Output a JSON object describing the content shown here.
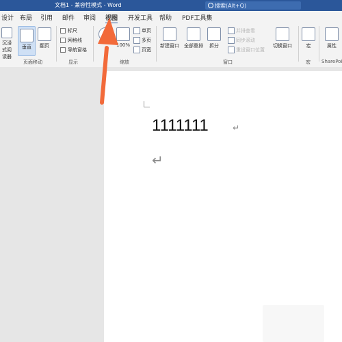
{
  "titlebar": {
    "title": "文档1 - 兼容性模式 - Word",
    "search_placeholder": "搜索(Alt+Q)"
  },
  "tabs": [
    "设计",
    "布局",
    "引用",
    "邮件",
    "审阅",
    "视图",
    "开发工具",
    "帮助",
    "PDF工具集"
  ],
  "active_tab": "视图",
  "ribbon": {
    "immersive_label": "沉浸式阅读器",
    "vertical_label": "垂直",
    "page_turn_label": "翻页",
    "page_move_group": "页面移动",
    "show_group": "显示",
    "ruler": "标尺",
    "gridlines": "网格线",
    "nav_pane": "导航窗格",
    "zoom_group": "缩放",
    "zoom_100": "100%",
    "single_page": "单页",
    "multi_page": "多页",
    "page_width": "页宽",
    "new_window": "新建窗口",
    "arrange_all": "全部重排",
    "split": "拆分",
    "side_by_side": "并排查看",
    "sync_scroll": "同步滚动",
    "reset_window_pos": "重设窗口位置",
    "switch_windows": "切换窗口",
    "window_group": "窗口",
    "macros": "宏",
    "macros_group": "宏",
    "properties": "属性",
    "sharepoint_group": "SharePoint"
  },
  "document": {
    "line1": "1111111",
    "paragraph_mark": "↵"
  },
  "colors": {
    "accent": "#2b579a",
    "arrow": "#f26a3a"
  }
}
